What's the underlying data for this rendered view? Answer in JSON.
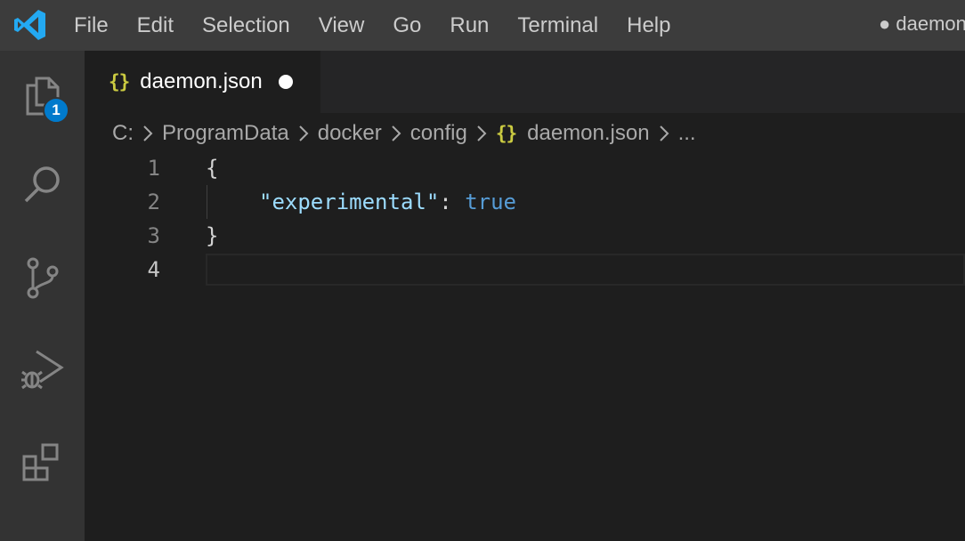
{
  "menu": {
    "items": [
      "File",
      "Edit",
      "Selection",
      "View",
      "Go",
      "Run",
      "Terminal",
      "Help"
    ]
  },
  "window_title": "● daemon",
  "activity_bar": {
    "items": [
      "files-icon",
      "search-icon",
      "source-control-icon",
      "run-debug-icon",
      "extensions-icon"
    ],
    "explorer_badge": "1"
  },
  "tab": {
    "icon": "{}",
    "label": "daemon.json"
  },
  "breadcrumb": {
    "segments": [
      "C:",
      "ProgramData",
      "docker",
      "config"
    ],
    "file_icon": "{}",
    "file": "daemon.json",
    "more": "..."
  },
  "editor": {
    "line_numbers": [
      "1",
      "2",
      "3",
      "4"
    ],
    "line1": "{",
    "line2_key": "\"experimental\"",
    "line2_colon": ": ",
    "line2_value": "true",
    "line3": "}"
  },
  "colors": {
    "accent": "#007acc",
    "json_icon": "#cbcb41",
    "key": "#9cdcfe",
    "boolean": "#569cd6"
  }
}
